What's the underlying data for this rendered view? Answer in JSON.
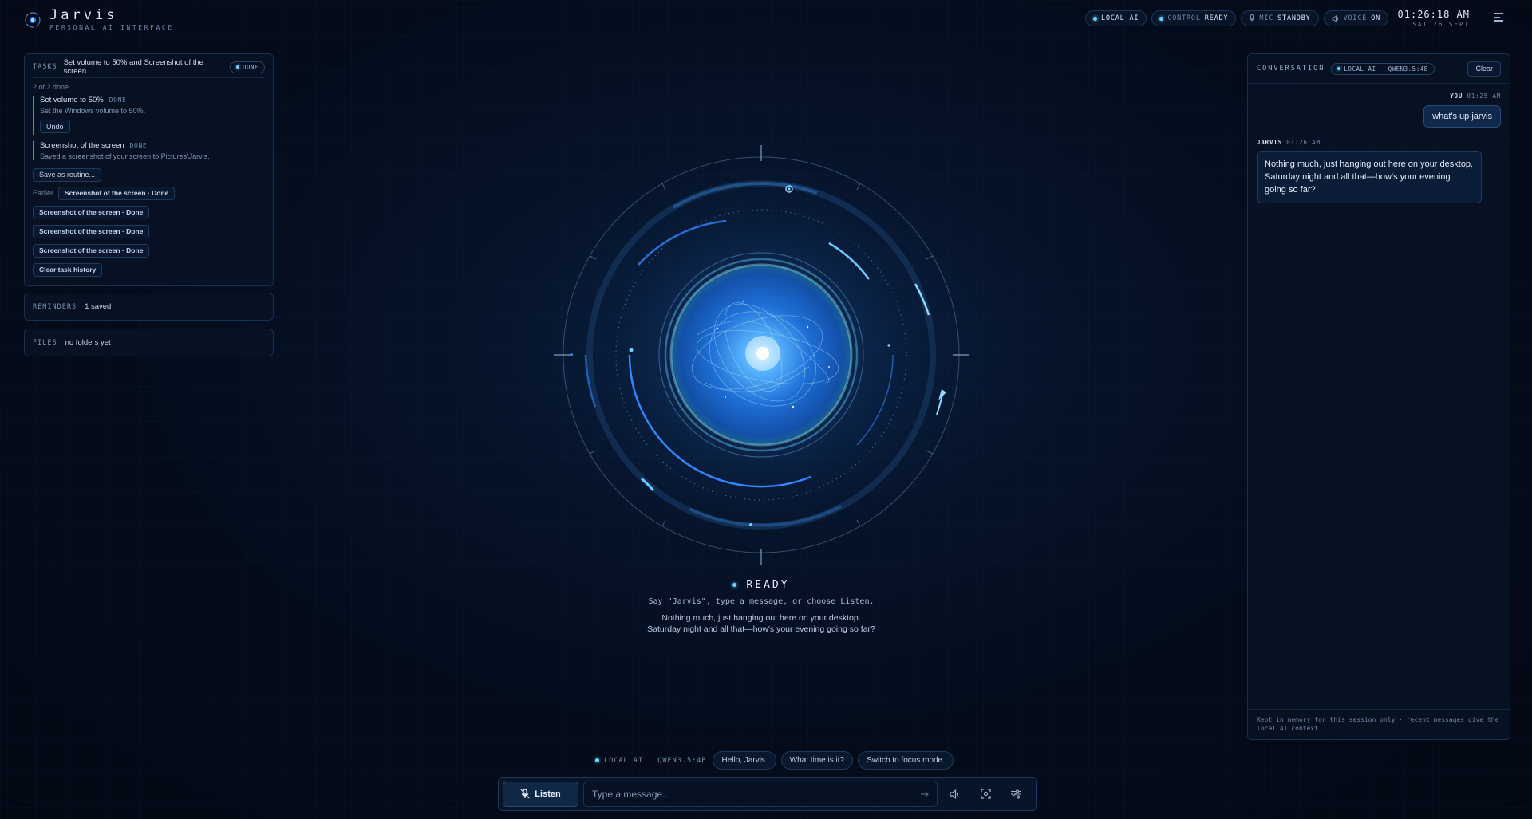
{
  "header": {
    "brand_name": "Jarvis",
    "brand_sub": "PERSONAL AI INTERFACE",
    "pills": [
      {
        "label": "LOCAL AI",
        "value": ""
      },
      {
        "label": "CONTROL",
        "value": "READY"
      },
      {
        "label": "MIC",
        "value": "STANDBY"
      },
      {
        "label": "VOICE",
        "value": "ON"
      }
    ],
    "time": "01:26:18 AM",
    "date": "SAT 26 SEPT"
  },
  "tasks": {
    "label": "TASKS",
    "title": "Set volume to 50% and Screenshot of the screen",
    "badge": "DONE",
    "progress": "2 of 2 done",
    "items": [
      {
        "name": "Set volume to 50%",
        "status": "DONE",
        "desc": "Set the Windows volume to 50%.",
        "action": "Undo"
      },
      {
        "name": "Screenshot of the screen",
        "status": "DONE",
        "desc": "Saved a screenshot of your screen to Pictures\\Jarvis."
      }
    ],
    "save_routine": "Save as routine...",
    "earlier_label": "Earlier",
    "history": [
      "Screenshot of the screen · Done",
      "Screenshot of the screen · Done",
      "Screenshot of the screen · Done",
      "Screenshot of the screen · Done"
    ],
    "clear_history": "Clear task history"
  },
  "reminders": {
    "label": "REMINDERS",
    "value": "1 saved"
  },
  "files": {
    "label": "FILES",
    "value": "no folders yet"
  },
  "center": {
    "status": "READY",
    "hint": "Say \"Jarvis\", type a message, or choose Listen.",
    "reply_line1": "Nothing much, just hanging out here on your desktop.",
    "reply_line2": "Saturday night and all that—how's your evening going so far?"
  },
  "conversation": {
    "label": "CONVERSATION",
    "model_badge": "LOCAL AI · QWEN3.5:4B",
    "clear": "Clear",
    "you_name": "YOU",
    "you_time": "01:25 AM",
    "you_msg": "what's up jarvis",
    "jarvis_name": "JARVIS",
    "jarvis_time": "01:26 AM",
    "jarvis_msg": "Nothing much, just hanging out here on your desktop. Saturday night and all that—how's your evening going so far?",
    "footer": "Kept in memory for this session only · recent messages give the local AI context"
  },
  "composer": {
    "model_tag": "LOCAL AI · QWEN3.5:4B",
    "suggestions": [
      "Hello, Jarvis.",
      "What time is it?",
      "Switch to focus mode."
    ],
    "listen_label": "Listen",
    "placeholder": "Type a message..."
  },
  "colors": {
    "accent": "#6fd0ff",
    "orb_core": "#2a7fe0",
    "success": "#2ea67a"
  }
}
